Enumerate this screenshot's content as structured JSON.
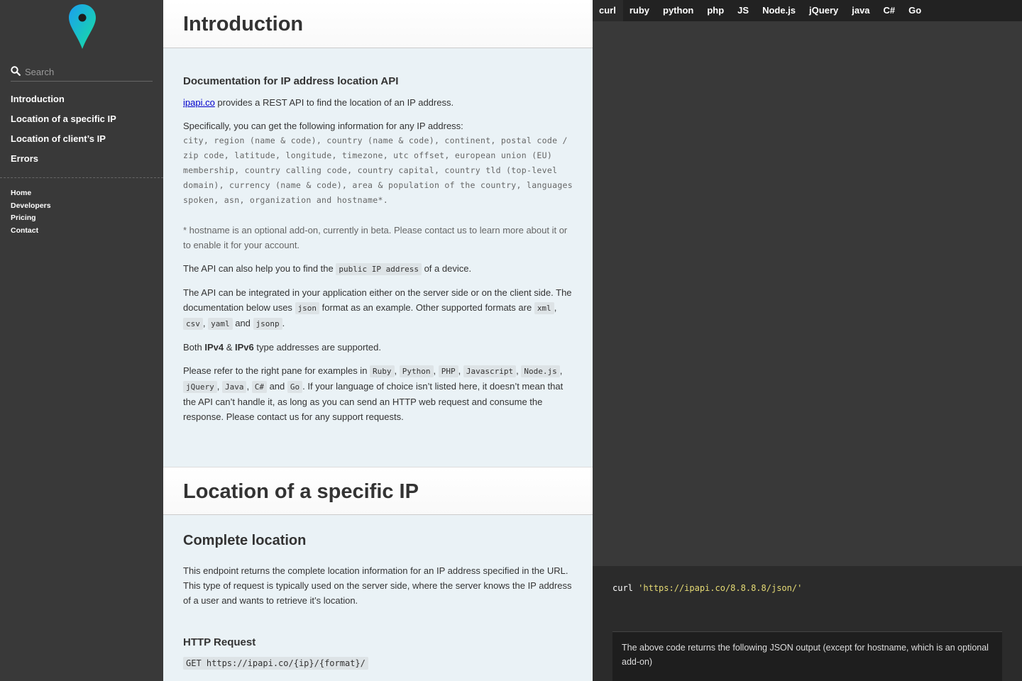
{
  "sidebar": {
    "logo_icon": "map-pin-icon",
    "search_placeholder": "Search",
    "toc": [
      "Introduction",
      "Location of a specific IP",
      "Location of client’s IP",
      "Errors"
    ],
    "footer_links": [
      "Home",
      "Developers",
      "Pricing",
      "Contact"
    ]
  },
  "intro": {
    "title": "Introduction",
    "subtitle": "Documentation for IP address location API",
    "p1_link": "ipapi.co",
    "p1_rest": " provides a REST API to find the location of an IP address.",
    "p2_lead": "Specifically, you can get the following information for any IP address:",
    "p2_fields": "city, region (name & code), country (name & code), continent, postal code / zip code, latitude, longitude, timezone, utc offset, european union (EU) membership, country calling code, country capital, country tld (top-level domain), currency (name & code), area & population of the country, languages spoken, asn, organization and hostname*.",
    "note": "* hostname is an optional add-on, currently in beta. Please contact us to learn more about it or to enable it for your account.",
    "p3_a": "The API can also help you to find the ",
    "p3_code": "public IP address",
    "p3_b": " of a device.",
    "p4_a": "The API can be integrated in your application either on the server side or on the client side. The documentation below uses ",
    "p4_code1": "json",
    "p4_b": " format as an example. Other supported formats are ",
    "p4_code2": "xml",
    "p4_c": ", ",
    "p4_code3": "csv",
    "p4_d": ", ",
    "p4_code4": "yaml",
    "p4_e": " and ",
    "p4_code5": "jsonp",
    "p4_f": ".",
    "p5_a": "Both ",
    "p5_b1": "IPv4",
    "p5_c": " & ",
    "p5_b2": "IPv6",
    "p5_d": " type addresses are supported.",
    "p6_a": "Please refer to the right pane for examples in ",
    "p6_langs": [
      "Ruby",
      "Python",
      "PHP",
      "Javascript",
      "Node.js",
      "jQuery",
      "Java",
      "C#",
      "Go"
    ],
    "p6_sep": ", ",
    "p6_and": " and ",
    "p6_b": ". If your language of choice isn’t listed here, it doesn’t mean that the API can’t handle it, as long as you can send an HTTP web request and consume the response. Please contact us for any support requests."
  },
  "specific": {
    "title": "Location of a specific IP",
    "subtitle": "Complete location",
    "desc": "This endpoint returns the complete location information for an IP address specified in the URL. This type of request is typically used on the server side, where the server knows the IP address of a user and wants to retrieve it’s location.",
    "http_heading": "HTTP Request",
    "http_request": "GET https://ipapi.co/{ip}/{format}/"
  },
  "right": {
    "tabs": [
      "curl",
      "ruby",
      "python",
      "php",
      "JS",
      "Node.js",
      "jQuery",
      "java",
      "C#",
      "Go"
    ],
    "active_tab": "curl",
    "code_cmd": "curl",
    "code_url": "'https://ipapi.co/8.8.8.8/json/'",
    "output_note": "The above code returns the following JSON output (except for hostname, which is an optional add-on)"
  }
}
